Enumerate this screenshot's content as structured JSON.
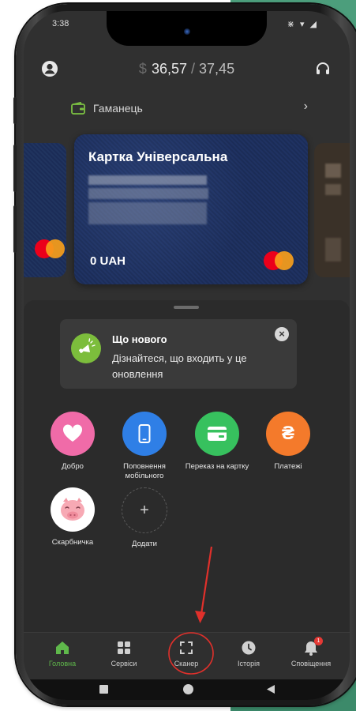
{
  "status": {
    "time": "3:38",
    "icons": "⋇ ▾ ◢"
  },
  "header": {
    "currency_symbol": "$",
    "balance": "36,57",
    "separator": "/",
    "limit": "37,45"
  },
  "wallet": {
    "label": "Гаманець"
  },
  "card": {
    "title": "Картка Універсальна",
    "amount": "0 UAH"
  },
  "notice": {
    "title": "Що нового",
    "text": "Дізнайтеся, що входить у це оновлення",
    "close": "×"
  },
  "services": [
    {
      "label": "Добро",
      "color": "#f06ba8",
      "icon": "heart-icon"
    },
    {
      "label": "Поповнення мобільного",
      "color": "#2f7fe6",
      "icon": "phone-icon"
    },
    {
      "label": "Переказ на картку",
      "color": "#37c15e",
      "icon": "card-icon"
    },
    {
      "label": "Платежі",
      "color": "#f47a2b",
      "icon": "hryvnia-icon",
      "glyph": "₴"
    },
    {
      "label": "Скарбничка",
      "color": "#ffffff",
      "icon": "piggy-bank-icon"
    },
    {
      "label": "Додати",
      "icon": "plus-icon",
      "glyph": "+"
    }
  ],
  "bottom_nav": [
    {
      "label": "Головна",
      "icon": "home-icon",
      "active": true
    },
    {
      "label": "Сервіси",
      "icon": "grid-icon"
    },
    {
      "label": "Сканер",
      "icon": "scan-icon"
    },
    {
      "label": "Історія",
      "icon": "clock-icon"
    },
    {
      "label": "Сповіщення",
      "icon": "bell-icon",
      "badge": "1"
    }
  ],
  "colors": {
    "accent_green": "#5fb84b",
    "annotation_red": "#e0302b"
  }
}
